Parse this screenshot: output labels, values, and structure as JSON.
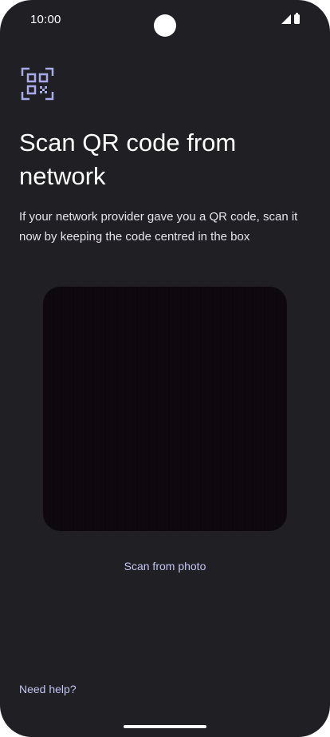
{
  "status_bar": {
    "time": "10:00",
    "icons": [
      "signal-icon",
      "battery-icon"
    ]
  },
  "header": {
    "icon": "qr-code-scan-icon",
    "title": "Scan QR code from network",
    "subtitle": "If your network provider gave you a QR code, scan it now by keeping the code centred in the box"
  },
  "scanner": {
    "scan_from_photo_label": "Scan from photo"
  },
  "footer": {
    "help_label": "Need help?"
  },
  "colors": {
    "background": "#1f1f24",
    "accent": "#c3c4f1",
    "icon": "#a8abe8",
    "viewfinder": "#0c080d",
    "text": "#ffffff"
  }
}
